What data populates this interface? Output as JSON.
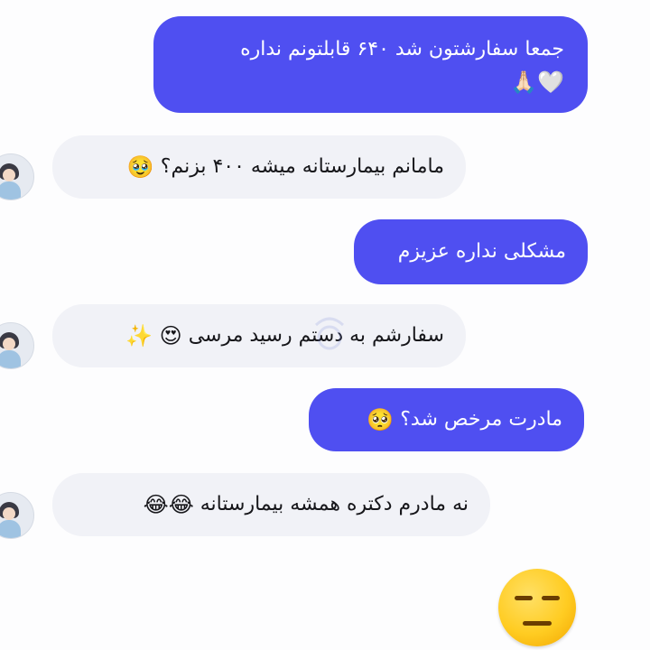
{
  "chat": {
    "messages": [
      {
        "direction": "outgoing",
        "line1": "جمعا سفارشتون شد ۶۴۰ قابلتونم نداره",
        "line2_emoji": "🤍🙏🏻"
      },
      {
        "direction": "incoming",
        "text": "مامانم بیمارستانه میشه ۴۰۰ بزنم؟",
        "emoji": "🥹"
      },
      {
        "direction": "outgoing",
        "text": "مشکلی نداره عزیزم"
      },
      {
        "direction": "incoming",
        "text": "سفارشم به دستم رسید مرسی",
        "emoji": "😍 ✨"
      },
      {
        "direction": "outgoing",
        "text": "مادرت مرخص شد؟",
        "emoji": "🥺"
      },
      {
        "direction": "incoming",
        "text": "نه مادرم دکتره همشه بیمارستانه",
        "emoji": "😂😂"
      }
    ],
    "reaction_emoji_name": "expressionless-face-icon"
  },
  "colors": {
    "outgoing_bubble": "#4f4ff1",
    "incoming_bubble": "#f1f2f7",
    "outgoing_text": "#ffffff",
    "incoming_text": "#16161a"
  }
}
